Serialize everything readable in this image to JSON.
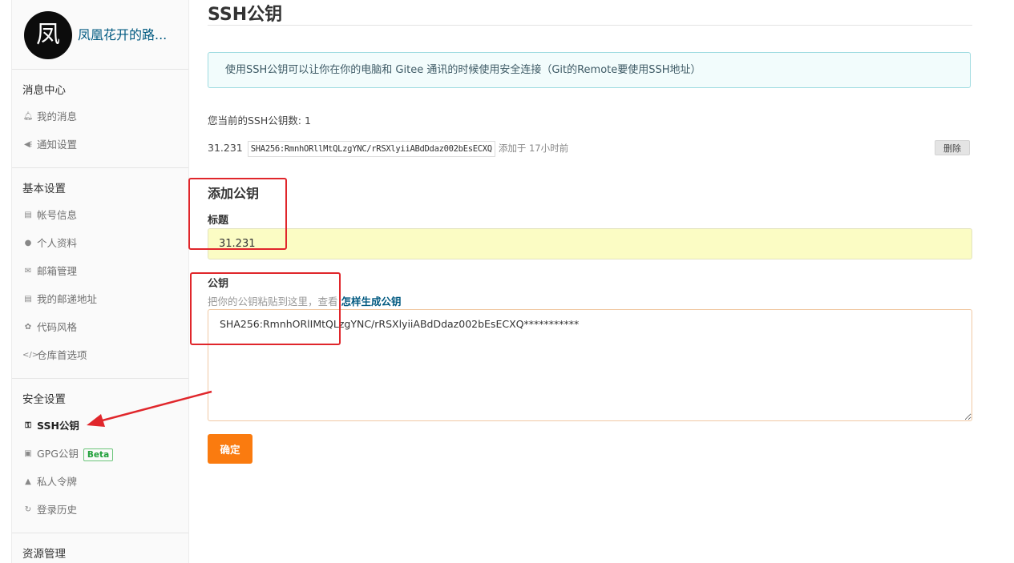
{
  "profile": {
    "avatar_char": "凤",
    "username": "凤凰花开的路..."
  },
  "sidebar": {
    "sections": [
      {
        "title": "消息中心",
        "items": [
          {
            "label": "我的消息",
            "icon": "bell-icon"
          },
          {
            "label": "通知设置",
            "icon": "speaker-icon"
          }
        ]
      },
      {
        "title": "基本设置",
        "items": [
          {
            "label": "帐号信息",
            "icon": "id-card-icon"
          },
          {
            "label": "个人资料",
            "icon": "user-icon"
          },
          {
            "label": "邮箱管理",
            "icon": "mail-icon"
          },
          {
            "label": "我的邮递地址",
            "icon": "address-card-icon"
          },
          {
            "label": "代码风格",
            "icon": "palette-icon"
          },
          {
            "label": "仓库首选项",
            "icon": "code-icon"
          }
        ]
      },
      {
        "title": "安全设置",
        "items": [
          {
            "label": "SSH公钥",
            "icon": "key-icon",
            "active": true
          },
          {
            "label": "GPG公钥",
            "icon": "lock-icon",
            "badge": "Beta"
          },
          {
            "label": "私人令牌",
            "icon": "user-secret-icon"
          },
          {
            "label": "登录历史",
            "icon": "history-icon"
          }
        ]
      },
      {
        "title": "资源管理",
        "items": []
      }
    ]
  },
  "main": {
    "title": "SSH公钥",
    "info": "使用SSH公钥可以让你在你的电脑和 Gitee 通讯的时候使用安全连接（Git的Remote要使用SSH地址）",
    "count_text": "您当前的SSH公钥数: 1",
    "keys": [
      {
        "name": "31.231",
        "fingerprint": "SHA256:RmnhORllMtQLzgYNC/rRSXlyiiABdDdaz002bEsECXQ",
        "added": "添加于 17小时前",
        "delete_label": "删除"
      }
    ],
    "add": {
      "heading": "添加公钥",
      "title_label": "标题",
      "title_value": "31.231",
      "key_label": "公钥",
      "hint_text": "把你的公钥粘贴到这里，查看 ",
      "hint_link": "怎样生成公钥",
      "key_value": "SHA256:RmnhORlIMtQLzgYNC/rRSXlyiiABdDdaz002bEsECXQ***********",
      "submit_label": "确定"
    }
  },
  "colors": {
    "accent": "#fa7b0f",
    "link": "#005980",
    "annotation": "#e0262b",
    "info_bg": "#f2fcfc",
    "input_highlight": "#fbfcc4"
  }
}
